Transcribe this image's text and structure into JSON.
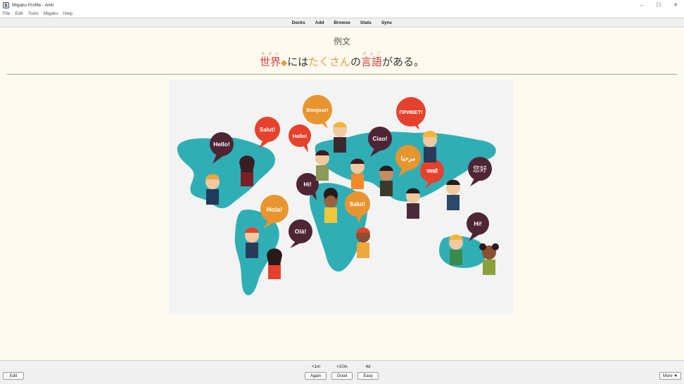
{
  "window": {
    "title": "Migaku Profile - Anki",
    "controls": {
      "minimize": "–",
      "maximize": "☐",
      "close": "✕"
    }
  },
  "menu": [
    "File",
    "Edit",
    "Tools",
    "Migaku",
    "Help"
  ],
  "toolbar": [
    "Decks",
    "Add",
    "Browse",
    "Stats",
    "Sync"
  ],
  "card": {
    "label": "例文",
    "sentence": {
      "w1": "世界",
      "w1_reading": "せかい",
      "diamond": "◆",
      "p1": "には",
      "w2": "たくさん",
      "p2": "の",
      "w3": "言語",
      "w3_reading": "げんご",
      "p3": "がある。"
    },
    "speech_bubbles": [
      "Hello!",
      "Salut!",
      "Bonjour!",
      "Hallo!",
      "ПРИВЕТ!",
      "Ciao!",
      "مرحبا",
      "नमस्ते",
      "您好",
      "Hi!",
      "Salut!",
      "Hola!",
      "Olá!",
      "Hi!"
    ]
  },
  "bottom": {
    "edit_label": "Edit",
    "more_label": "More ▼",
    "answers": [
      {
        "interval": "<1m",
        "label": "Again"
      },
      {
        "interval": "<10m",
        "label": "Good"
      },
      {
        "interval": "4d",
        "label": "Easy"
      }
    ]
  },
  "colors": {
    "map": "#30aeb6",
    "bubble_dark": "#4e2534",
    "bubble_red": "#e5422d",
    "bubble_orange": "#e8952f",
    "card_bg": "#fffaf0"
  }
}
